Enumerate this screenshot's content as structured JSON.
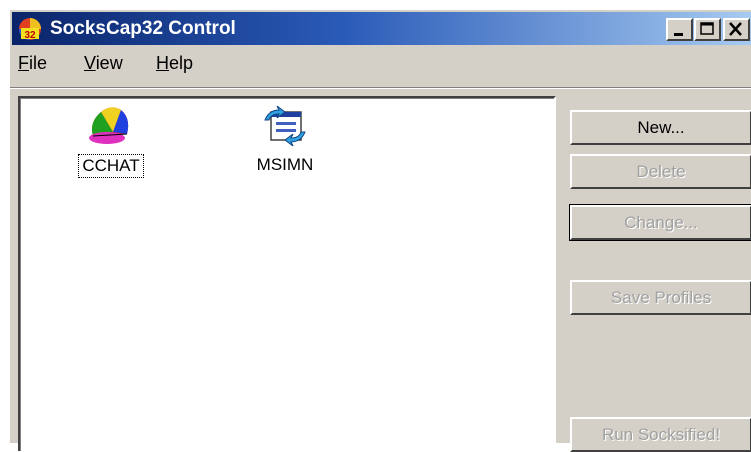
{
  "window": {
    "title": "SocksCap32 Control",
    "title_icon": "sockscap-32-icon",
    "controls": [
      "minimize",
      "maximize",
      "close"
    ]
  },
  "menu": {
    "items": [
      {
        "label": "File"
      },
      {
        "label": "View"
      },
      {
        "label": "Help"
      }
    ]
  },
  "list": {
    "entries": [
      {
        "label": "CCHAT",
        "icon": "cchat-cap-icon",
        "selected": true
      },
      {
        "label": "MSIMN",
        "icon": "msimn-mail-icon",
        "selected": false
      }
    ]
  },
  "buttons": {
    "new": "New...",
    "delete": "Delete",
    "change": "Change...",
    "save_profiles": "Save Profiles",
    "run_socksified": "Run Socksified!"
  },
  "colors": {
    "titlebar_start": "#0a246a",
    "titlebar_end": "#a6caf0",
    "face": "#d4d0c8",
    "disabled_text": "#a0a0a0"
  }
}
